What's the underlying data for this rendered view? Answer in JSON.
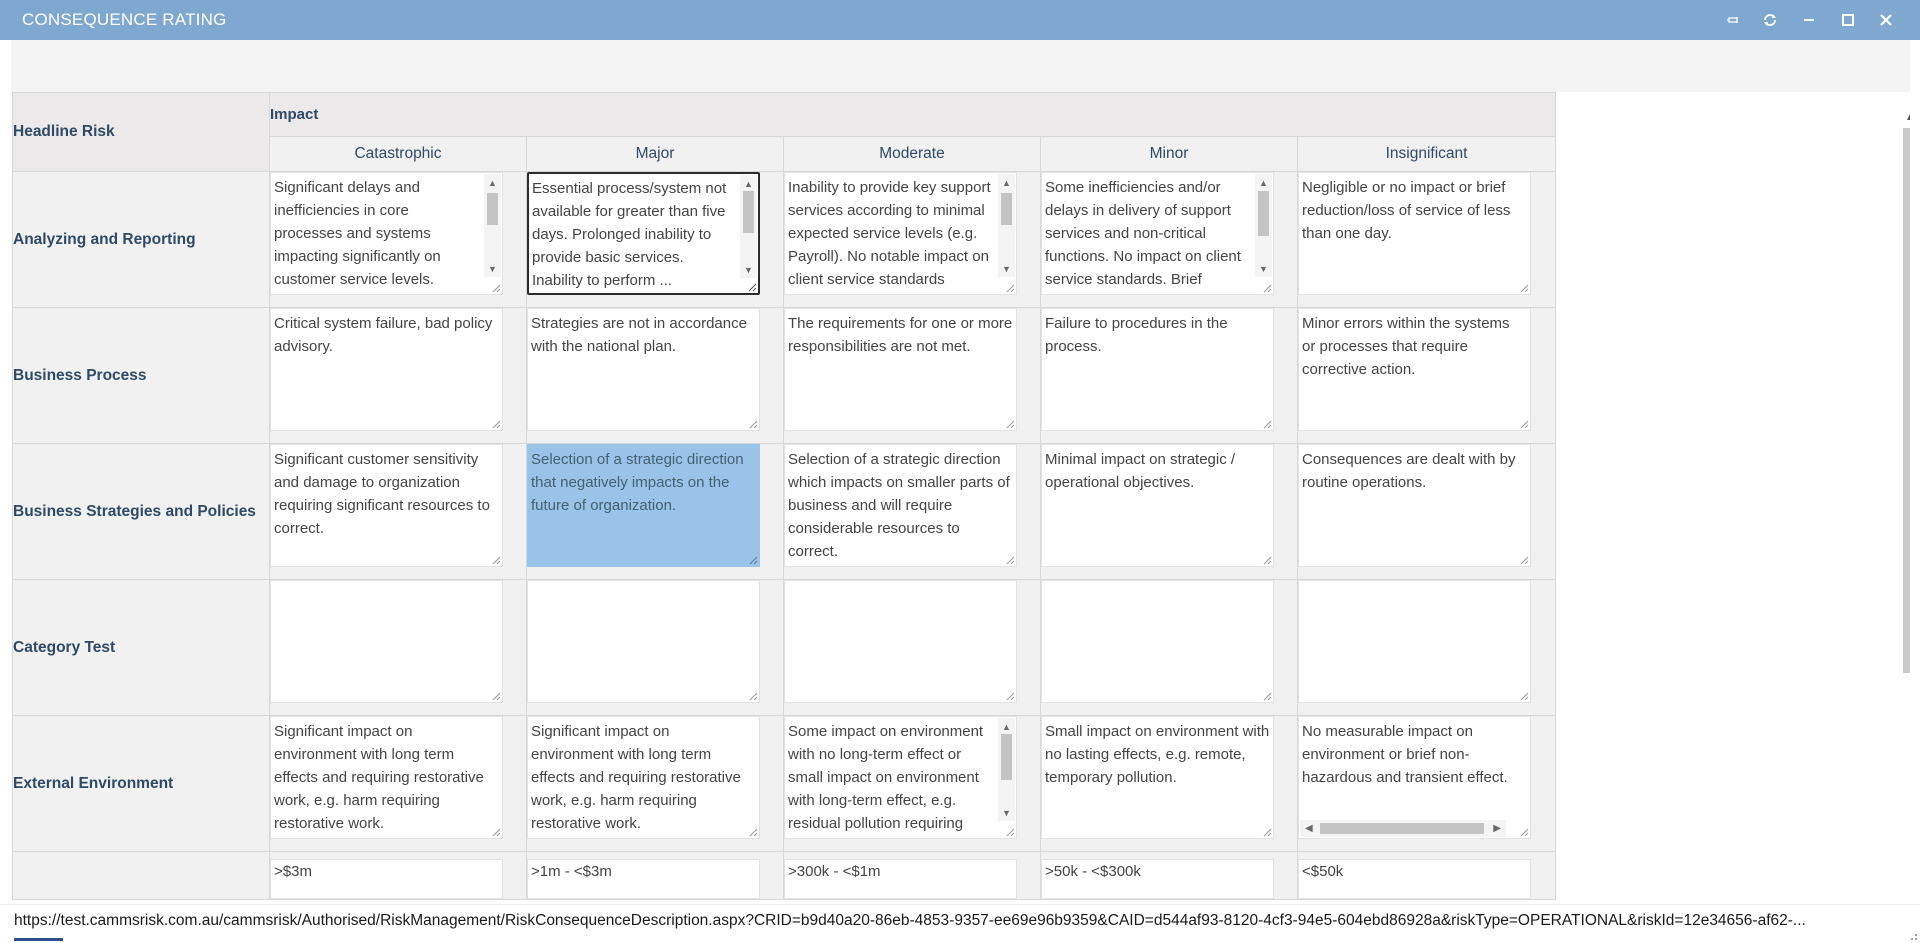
{
  "window": {
    "title": "CONSEQUENCE RATING",
    "controls": [
      "pin-icon",
      "refresh-icon",
      "minimize-icon",
      "maximize-icon",
      "close-icon"
    ]
  },
  "table": {
    "headline_label": "Headline Risk",
    "impact_label": "Impact",
    "columns": [
      "Catastrophic",
      "Major",
      "Moderate",
      "Minor",
      "Insignificant"
    ],
    "rows": [
      {
        "label": "Analyzing and Reporting",
        "cells": [
          "Significant delays and inefficiencies in core processes and systems impacting significantly on customer service levels. Services provided...",
          "Essential process/system not available for greater than five days. Prolonged inability to provide basic services. Inability to perform ...",
          "Inability to provide key support services according to minimal expected service levels (e.g. Payroll). No notable impact on client service standards",
          "Some inefficiencies and/or delays in delivery of support services and non-critical functions. No impact on client service standards. Brief service interruption",
          "Negligible or no impact or brief reduction/loss of service of less than one day."
        ]
      },
      {
        "label": "Business Process",
        "cells": [
          "Critical system failure, bad policy advisory.",
          "Strategies are not in accordance with the national plan.",
          "The requirements for one or more responsibilities are not met.",
          "Failure to procedures in the process.",
          "Minor errors within the systems or processes that require corrective action."
        ]
      },
      {
        "label": "Business Strategies and Policies",
        "cells": [
          "Significant customer sensitivity and damage to organization requiring significant resources to correct.",
          "Selection of a strategic direction that negatively impacts on the future of organization.",
          "Selection of a strategic direction which impacts on smaller parts of business and will require considerable resources to correct.",
          "Minimal impact on strategic / operational objectives.",
          "Consequences are dealt with by routine operations."
        ]
      },
      {
        "label": "Category Test",
        "cells": [
          "",
          "",
          "",
          "",
          ""
        ]
      },
      {
        "label": "External Environment",
        "cells": [
          "Significant impact on environment with long term effects and requiring restorative work, e.g. harm requiring restorative work.",
          "Significant impact on environment with long term effects and requiring restorative work, e.g. harm requiring restorative work.",
          "Some impact on environment with no long-term effect or small impact on environment with long-term effect, e.g. residual pollution requiring clean-up.",
          "Small impact on environment with no lasting effects, e.g. remote, temporary pollution.",
          "No measurable impact on environment or brief non-hazardous and transient effect."
        ]
      },
      {
        "label": "",
        "cells": [
          ">$3m",
          ">1m - <$3m",
          ">300k - <$1m",
          ">50k - <$300k",
          "<$50k"
        ]
      }
    ]
  },
  "status": {
    "url": "https://test.cammsrisk.com.au/cammsrisk/Authorised/RiskManagement/RiskConsequenceDescription.aspx?CRID=b9d40a20-86eb-4853-9357-ee69e96b9359&CAID=d544af93-8120-4cf3-94e5-604ebd86928a&riskType=OPERATIONAL&riskId=12e34656-af62-..."
  },
  "colors": {
    "titlebar": "#7fa8d0",
    "header_text": "#2e4a66",
    "highlight": "#9ac3ea"
  }
}
